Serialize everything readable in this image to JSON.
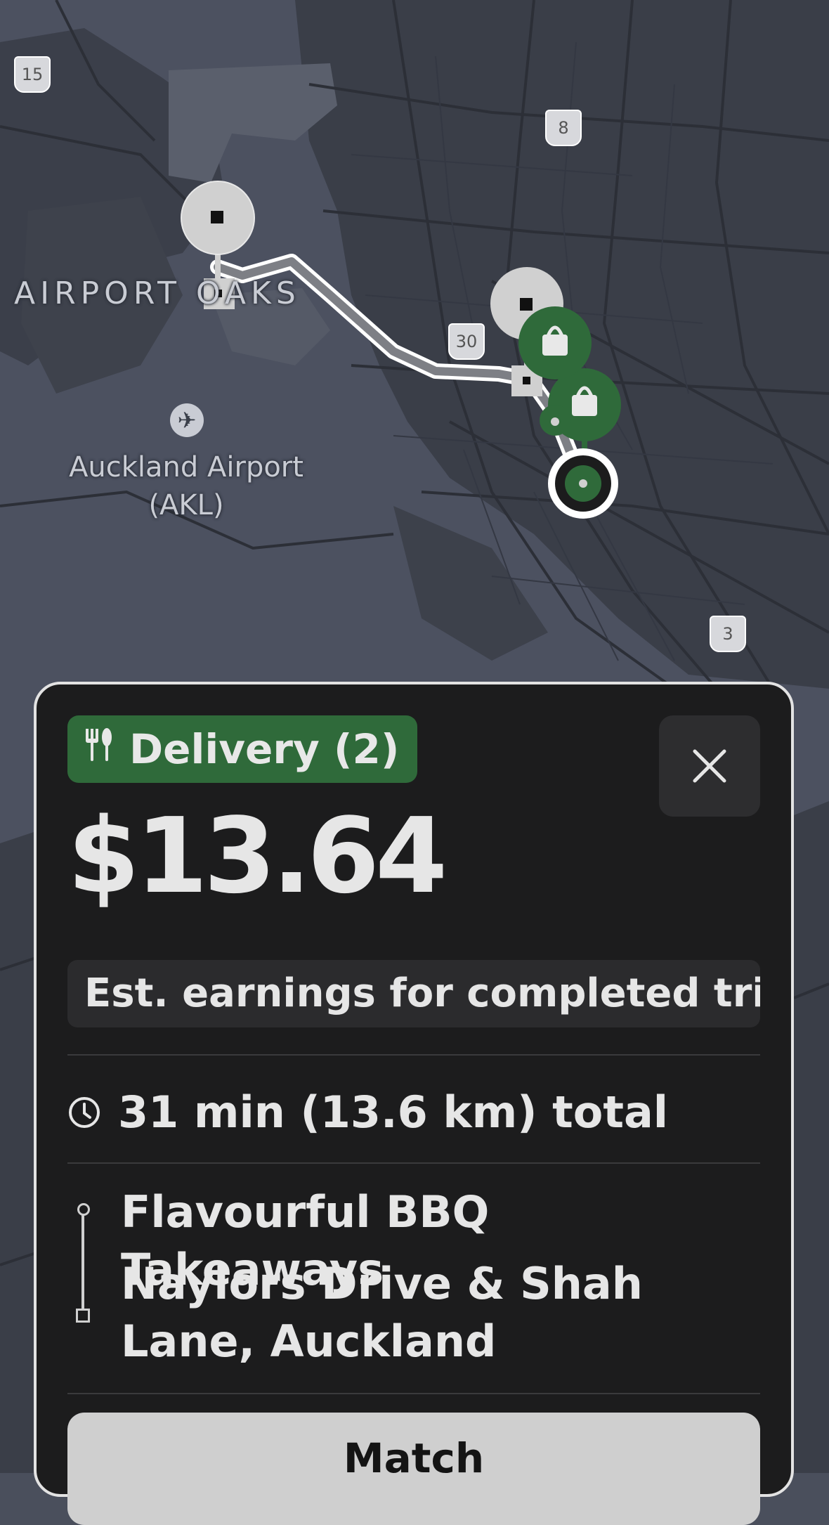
{
  "map": {
    "area_label": "AIRPORT OAKS",
    "airport_label_line1": "Auckland Airport",
    "airport_label_line2": "(AKL)",
    "route_shields": [
      "15",
      "8",
      "30",
      "3"
    ],
    "icons": [
      "airplane-icon",
      "shopping-bag-icon",
      "shopping-bag-icon",
      "navigation-arrow-icon"
    ],
    "colors": {
      "route": "#8a8a8a",
      "pickup_pin": "#2f6a3a",
      "pin_neutral": "#d0d0d0"
    }
  },
  "offer": {
    "tag_icon": "cutlery-icon",
    "tag_label": "Delivery (2)",
    "close_icon": "close-icon",
    "price": "$13.64",
    "earnings_note": "Est. earnings for completed trip",
    "time_icon": "clock-icon",
    "time_summary": "31 min (13.6 km) total",
    "pickup": "Flavourful BBQ Takeaways",
    "dropoff": "Naylors Drive & Shah Lane, Auckland",
    "match_label": "Match"
  },
  "colors": {
    "card_bg": "#1c1c1d",
    "tag_bg": "#2f6a3a",
    "button_bg": "#cfcfcf"
  }
}
